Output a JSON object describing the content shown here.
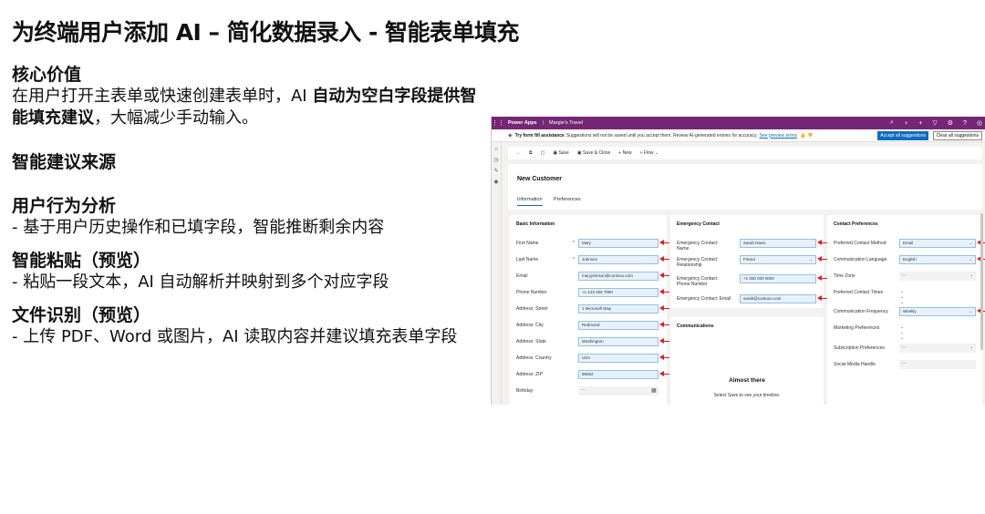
{
  "slide": {
    "title": "为终端用户添加 AI – 简化数据录入 - 智能表单填充",
    "core_heading": "核心价值",
    "core_pre": "在用户打开主表单或快速创建表单时，AI ",
    "core_bold": "自动为空白字段提供智能填充建议",
    "core_post": "，大幅减少手动输入。",
    "source_heading": "智能建议来源",
    "behavior_heading": "用户行为分析",
    "behavior_text": "- 基于用户历史操作和已填字段，智能推断剩余内容",
    "paste_heading": "智能粘贴（预览）",
    "paste_text": "- 粘贴一段文本，AI 自动解析并映射到多个对应字段",
    "file_heading": "文件识别（预览）",
    "file_text": "- 上传 PDF、Word 或图片，AI 读取内容并建议填充表单字段"
  },
  "app": {
    "name": "Power Apps",
    "environment": "Margie's Travel",
    "banner_title": "Try form fill assistance",
    "banner_msg": "Suggestions will not be saved until you accept them. Review AI-generated entries for accuracy.",
    "banner_link": "See preview terms",
    "accept_all": "Accept all suggestions",
    "clear_all": "Clear all suggestions",
    "cmd": {
      "save": "Save",
      "save_close": "Save & Close",
      "new": "New",
      "flow": "Flow"
    },
    "record_title": "New Customer",
    "tabs": [
      "Information",
      "Preferences"
    ],
    "basic": {
      "title": "Basic Information",
      "fields": [
        {
          "label": "First Name",
          "value": "Mary"
        },
        {
          "label": "Last Name",
          "value": "Johnson"
        },
        {
          "label": "Email",
          "value": "maryjohnson@contoso.com"
        },
        {
          "label": "Phone Number",
          "value": "+1 123 456 7890"
        },
        {
          "label": "Address: Street",
          "value": "1 Microsoft Way"
        },
        {
          "label": "Address: City",
          "value": "Redmond"
        },
        {
          "label": "Address: State",
          "value": "Washington"
        },
        {
          "label": "Address: Country",
          "value": "USA"
        },
        {
          "label": "Address: ZIP",
          "value": "98052"
        },
        {
          "label": "Birthday",
          "value": "---"
        }
      ]
    },
    "emergency": {
      "title": "Emergency Contact",
      "fields": [
        {
          "label": "Emergency Contact: Name",
          "value": "Sarah Davis"
        },
        {
          "label": "Emergency Contact: Relationship",
          "value": "Friend"
        },
        {
          "label": "Emergency Contact: Phone Number",
          "value": "+1 000 000 0000"
        },
        {
          "label": "Emergency Contact: Email",
          "value": "sarah@contoso.com"
        }
      ]
    },
    "communications": {
      "title": "Communications",
      "almost_there": "Almost there",
      "hint": "Select Save to see your timeline."
    },
    "contact": {
      "title": "Contact Preferences",
      "fields": [
        {
          "label": "Preferred Contact Method",
          "value": "Email"
        },
        {
          "label": "Communication Language",
          "value": "English"
        },
        {
          "label": "Time Zone",
          "value": "---"
        },
        {
          "label": "Preferred Contact Times",
          "value": "---"
        },
        {
          "label": "Communication Frequency",
          "value": "Weekly"
        },
        {
          "label": "Marketing Preferences",
          "value": "---"
        },
        {
          "label": "Subscription Preferences",
          "value": "---"
        },
        {
          "label": "Social Media Handle",
          "value": "---"
        }
      ]
    }
  }
}
